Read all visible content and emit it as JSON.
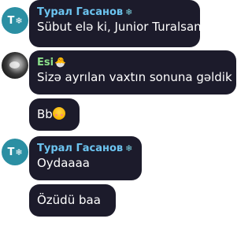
{
  "messages": [
    {
      "sender": "Турал Гасанов",
      "sender_decoration": "❄",
      "avatar_initial": "T",
      "avatar_badge": "❄",
      "text": "Sübut elə ki, Junior Turalsan"
    },
    {
      "sender": "Esi",
      "sender_decoration": "🐣",
      "text": "Sizə ayrılan vaxtın sonuna gəldik"
    },
    {
      "text": "Bb",
      "emoji": "blushing-smile-emoji"
    },
    {
      "sender": "Турал Гасанов",
      "sender_decoration": "❄",
      "avatar_initial": "T",
      "avatar_badge": "❄",
      "text": "Oydaaaa"
    },
    {
      "text": "Özüdü baa"
    }
  ],
  "colors": {
    "bubble_bg": "#1c1b2b",
    "message_text": "#ffffff",
    "tural_name": "#6cc4f0",
    "esi_name": "#8be08a",
    "avatar_t_bg": "#2b8fa3"
  }
}
